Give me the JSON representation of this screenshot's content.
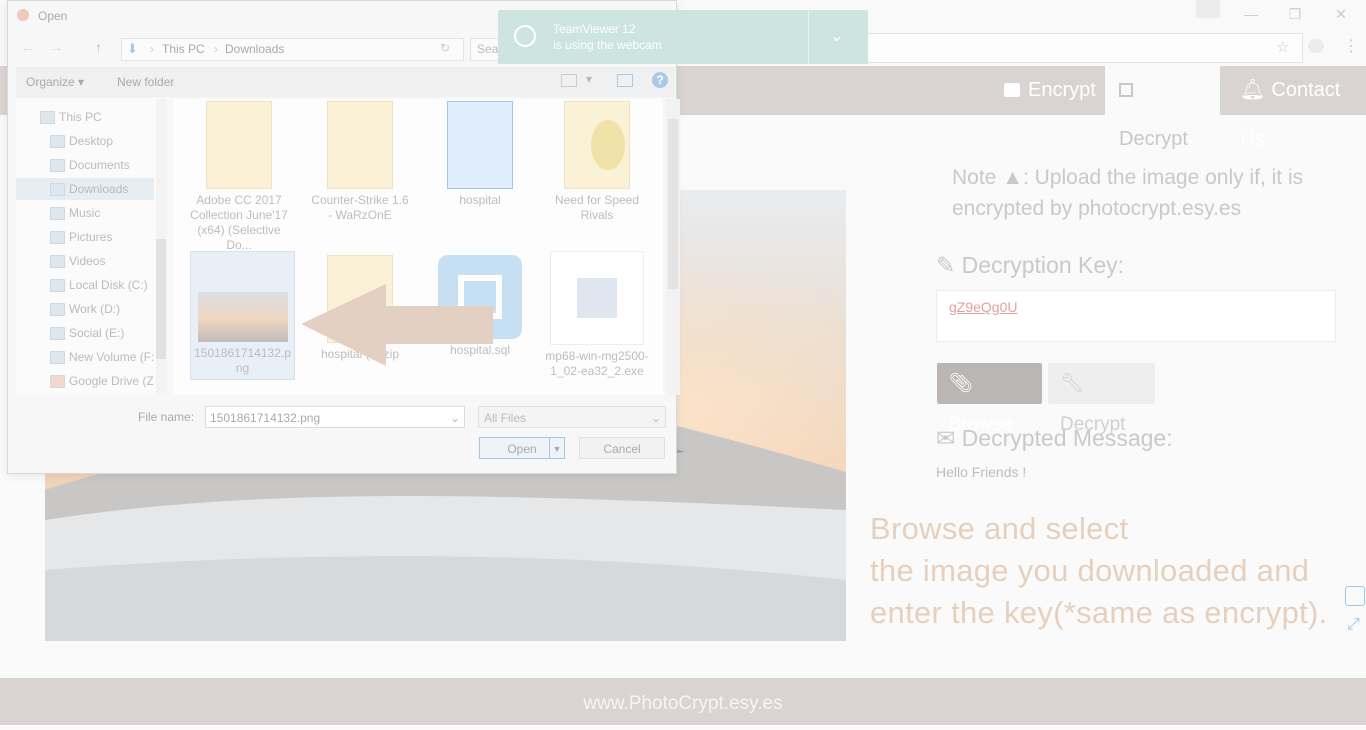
{
  "browser": {
    "window_controls": [
      "—",
      "❐",
      "✕"
    ]
  },
  "site": {
    "nav": {
      "encrypt": "Encrypt",
      "decrypt": "Decrypt",
      "contact": "Contact Us"
    },
    "note_prefix": "Note",
    "note_text": ": Upload the image only if, it is encrypted by photocrypt.esy.es",
    "key_label": "Decryption Key:",
    "key_value": "gZ9eQg0U",
    "browse_button": "Browse",
    "decrypt_button": "Decrypt",
    "message_label": "Decrypted Message:",
    "message_value": "Hello Friends !",
    "instruction_line1": "Browse and select",
    "instruction_line2": "the image you downloaded and",
    "instruction_line3": "enter the key(*same as encrypt).",
    "footer": "www.PhotoCrypt.esy.es"
  },
  "dialog": {
    "title": "Open",
    "breadcrumb": [
      "This PC",
      "Downloads"
    ],
    "search_placeholder": "Searc",
    "organize": "Organize ▾",
    "new_folder": "New folder",
    "nav_items": [
      {
        "label": "This PC",
        "icon": "pc-icon"
      },
      {
        "label": "Desktop",
        "icon": "desktop-icon"
      },
      {
        "label": "Documents",
        "icon": "documents-icon"
      },
      {
        "label": "Downloads",
        "icon": "downloads-icon"
      },
      {
        "label": "Music",
        "icon": "music-icon"
      },
      {
        "label": "Pictures",
        "icon": "pictures-icon"
      },
      {
        "label": "Videos",
        "icon": "videos-icon"
      },
      {
        "label": "Local Disk (C:)",
        "icon": "drive-icon"
      },
      {
        "label": "Work (D:)",
        "icon": "drive-icon"
      },
      {
        "label": "Social (E:)",
        "icon": "drive-icon"
      },
      {
        "label": "New Volume (F:)",
        "icon": "drive-icon"
      },
      {
        "label": "Google Drive (Z:",
        "icon": "drive-icon"
      }
    ],
    "files": [
      {
        "name": "Adobe CC 2017 Collection June'17 (x64) (Selective Do...",
        "kind": "folder"
      },
      {
        "name": "Counter-Strike 1.6 - WaRzOnE",
        "kind": "folder"
      },
      {
        "name": "hospital",
        "kind": "folder-app"
      },
      {
        "name": "Need for Speed Rivals",
        "kind": "folder-disc"
      },
      {
        "name": "1501861714132.png",
        "kind": "image"
      },
      {
        "name": "hospital (1).zip",
        "kind": "zip"
      },
      {
        "name": "hospital.sql",
        "kind": "brackets"
      },
      {
        "name": "mp68-win-mg2500-1_02-ea32_2.exe",
        "kind": "exe"
      }
    ],
    "filename_label": "File name:",
    "filename_value": "1501861714132.png",
    "filetype": "All Files",
    "open_button": "Open",
    "cancel_button": "Cancel"
  },
  "teamviewer": {
    "line1": "TeamViewer 12",
    "line2": "is using the webcam"
  }
}
